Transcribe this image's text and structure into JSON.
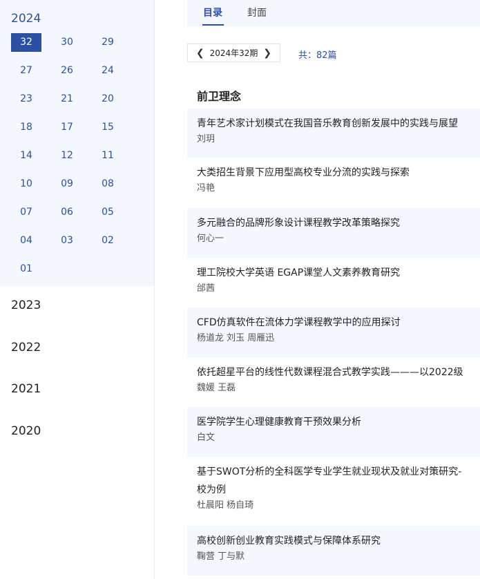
{
  "sidebar": {
    "open_year": "2024",
    "issues": [
      "32",
      "30",
      "29",
      "27",
      "26",
      "24",
      "23",
      "21",
      "20",
      "18",
      "17",
      "15",
      "14",
      "12",
      "11",
      "10",
      "09",
      "08",
      "07",
      "06",
      "05",
      "04",
      "03",
      "02",
      "01"
    ],
    "selected_issue": "32",
    "other_years": [
      "2023",
      "2022",
      "2021",
      "2020"
    ]
  },
  "tabs": [
    "目录",
    "封面"
  ],
  "issue_nav": {
    "label": "2024年32期",
    "prev_icon": "chevron-left-icon",
    "next_icon": "chevron-right-icon"
  },
  "total_text": "共：82篇",
  "section_title": "前卫理念",
  "articles": [
    {
      "title": "青年艺术家计划模式在我国音乐教育创新发展中的实践与展望",
      "authors": "刘玥"
    },
    {
      "title": "大类招生背景下应用型高校专业分流的实践与探索",
      "authors": "冯艳"
    },
    {
      "title": "多元融合的品牌形象设计课程教学改革策略探究",
      "authors": "何心一"
    },
    {
      "title": "理工院校大学英语 EGAP课堂人文素养教育研究",
      "authors": "邰茜"
    },
    {
      "title": "CFD仿真软件在流体力学课程教学中的应用探讨",
      "authors": "杨道龙 刘玉 周雁迅"
    },
    {
      "title": "依托超星平台的线性代数课程混合式教学实践———以2022级",
      "authors": "魏媛 王磊"
    },
    {
      "title": "医学院学生心理健康教育干预效果分析",
      "authors": "白文"
    },
    {
      "title": "基于SWOT分析的全科医学专业学生就业现状及就业对策研究-",
      "title2": "校为例",
      "authors": "杜晨阳 杨自琦"
    },
    {
      "title": "高校创新创业教育实践模式与保障体系研究",
      "authors": "鞠营 丁与默"
    }
  ],
  "colors": {
    "accent": "#2b4fa3",
    "panel_bg": "#f4f8fe"
  }
}
